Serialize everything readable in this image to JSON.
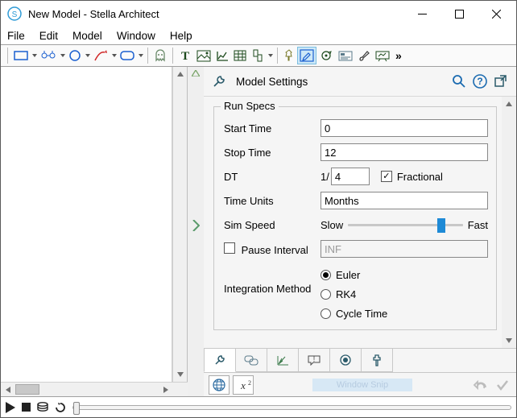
{
  "window": {
    "title": "New Model - Stella Architect"
  },
  "menu": {
    "file": "File",
    "edit": "Edit",
    "model": "Model",
    "window": "Window",
    "help": "Help"
  },
  "toolbar_overflow": "»",
  "panel": {
    "title": "Model Settings",
    "group": "Run Specs",
    "labels": {
      "start_time": "Start Time",
      "stop_time": "Stop Time",
      "dt": "DT",
      "dt_prefix": "1/",
      "fractional": "Fractional",
      "time_units": "Time Units",
      "sim_speed": "Sim Speed",
      "slow": "Slow",
      "fast": "Fast",
      "pause_interval": "Pause Interval",
      "integration": "Integration Method",
      "euler": "Euler",
      "rk4": "RK4",
      "cycle_time": "Cycle Time"
    },
    "values": {
      "start_time": "0",
      "stop_time": "12",
      "dt": "4",
      "fractional_checked": true,
      "time_units": "Months",
      "pause_interval_checked": false,
      "pause_interval": "INF",
      "integration_selected": "Euler",
      "sim_speed_percent": 78
    }
  },
  "footer": {
    "snip": "Window Snip"
  },
  "icons": {
    "stock": "stock",
    "module": "module",
    "converter": "converter",
    "flow": "flow",
    "container": "container",
    "ghost": "ghost",
    "text": "text",
    "graphics": "graphics",
    "graph": "graph",
    "table": "table",
    "numeric": "numeric",
    "button": "button",
    "find": "find",
    "causal": "causal",
    "loop": "loop",
    "story": "story",
    "annotation": "annotation",
    "presentation": "presentation",
    "wrench": "wrench",
    "search": "search",
    "help": "help",
    "popout": "popout",
    "globe": "globe",
    "x2": "x2",
    "undo": "undo",
    "confirm": "confirm"
  }
}
